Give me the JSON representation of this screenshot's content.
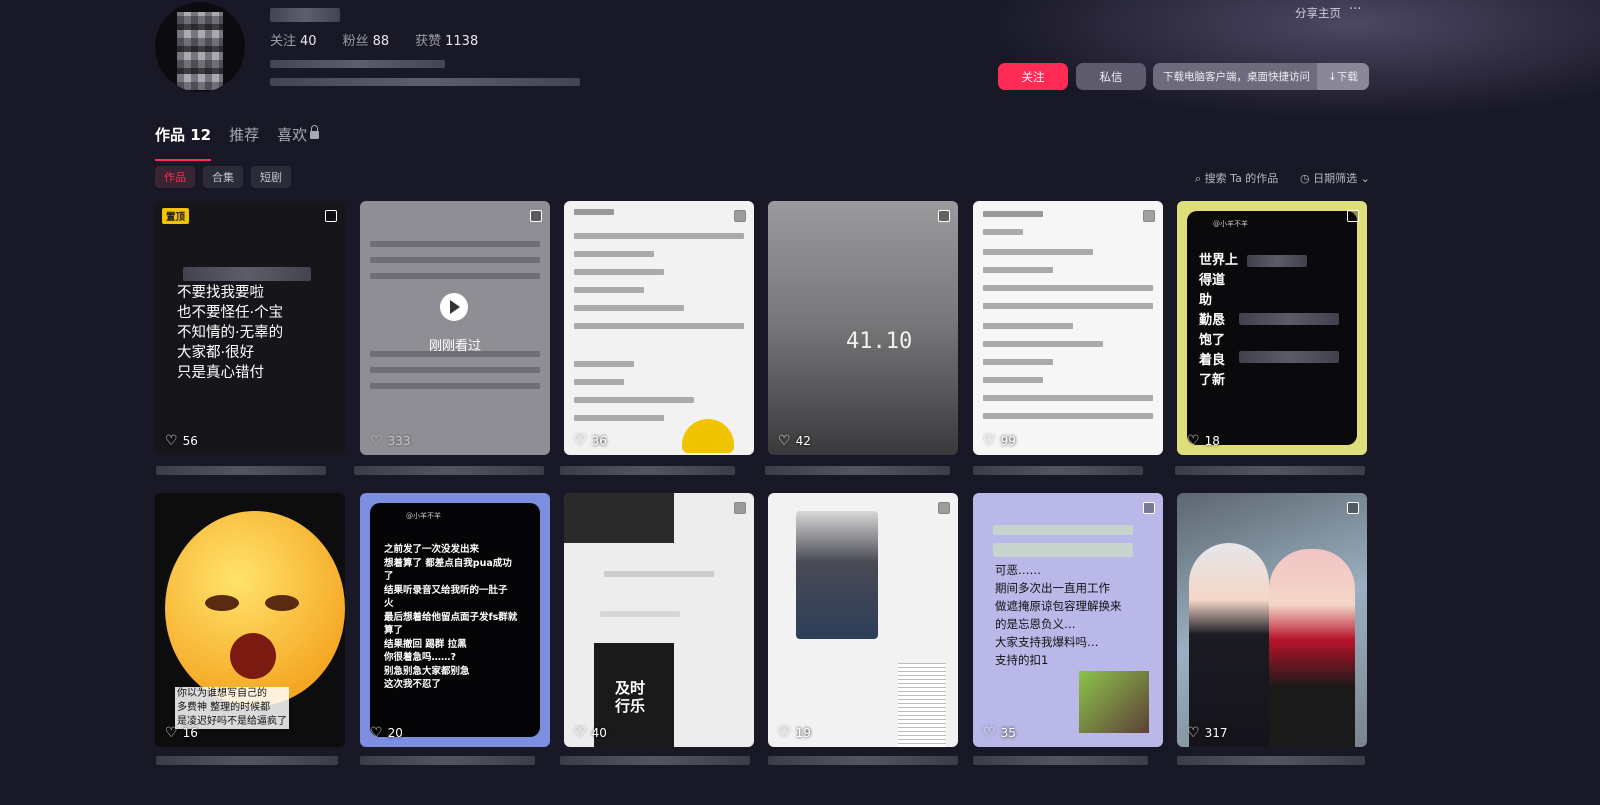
{
  "profile": {
    "stats": [
      {
        "key": "关注",
        "value": "40"
      },
      {
        "key": "粉丝",
        "value": "88"
      },
      {
        "key": "获赞",
        "value": "1138"
      }
    ]
  },
  "header": {
    "share_label": "分享主页",
    "more_label": "···",
    "follow_label": "关注",
    "message_label": "私信",
    "download_text": "下载电脑客户端，桌面快捷访问",
    "download_button": "↓下载"
  },
  "tabs": [
    {
      "label": "作品 12",
      "active": true
    },
    {
      "label": "推荐",
      "active": false
    },
    {
      "label": "喜欢",
      "active": false,
      "locked": true
    }
  ],
  "filters": {
    "chips": [
      "作品",
      "合集",
      "短剧"
    ],
    "search_label": "搜索 Ta 的作品",
    "date_label": "日期筛选"
  },
  "videos": [
    {
      "likes": "56",
      "pinned_label": "置顶",
      "text": "不要找我要啦\n也不要怪任·个宝\n不知情的·无辜的\n大家都·很好\n只是真心错付"
    },
    {
      "likes": "333",
      "overlay": "刚刚看过"
    },
    {
      "likes": "36"
    },
    {
      "likes": "42",
      "number": "41.10"
    },
    {
      "likes": "99"
    },
    {
      "likes": "18",
      "author": "@小羊不羊",
      "text": "世界上\n得道\n助\n勤恳\n饱了\n着良\n了新"
    },
    {
      "likes": "16",
      "text": "你以为谁想写自己的\n多费神 整理的时候都\n是凌迟好吗不是给逼疯了\n"
    },
    {
      "likes": "20",
      "author": "@小羊不羊",
      "text": "之前发了一次没发出来\n想着算了 都差点自我pua成功\n了\n结果听录音又给我听的一肚子\n火\n最后想着给他留点面子发fs群就\n算了\n结果撤回 踢群 拉黑\n你很着急吗……?\n别急别急大家都别急\n这次我不忍了"
    },
    {
      "likes": "40",
      "sign": "及时\n行乐"
    },
    {
      "likes": "19"
    },
    {
      "likes": "35",
      "text": "可恶……\n期间多次出一直用工作\n做遮掩原谅包容理解换来\n的是忘恩负义…\n大家支持我爆料吗…\n支持的扣1"
    },
    {
      "likes": "317"
    }
  ]
}
